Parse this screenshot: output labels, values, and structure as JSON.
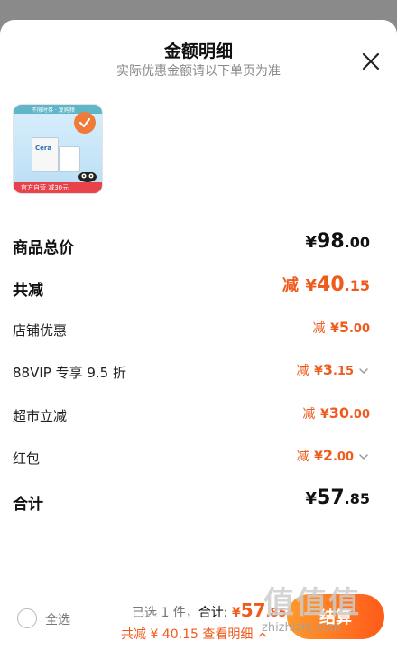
{
  "header": {
    "title": "金额明细",
    "subtitle": "实际优惠金额请以下单页为准"
  },
  "product": {
    "thumb_top_text": "不限时券 · 复购频",
    "thumb_mid_text": "Cera",
    "thumb_bottom_text": "官方自营 减30元"
  },
  "rows": {
    "subtotal": {
      "label": "商品总价",
      "currency": "¥",
      "int": "98",
      "dec": ".00"
    },
    "total_discount": {
      "label": "共减",
      "prefix": "减",
      "currency": "¥",
      "int": "40",
      "dec": ".15"
    },
    "shop_coupon": {
      "label": "店铺优惠",
      "prefix": "减",
      "currency": "¥",
      "int": "5",
      "dec": ".00"
    },
    "vip": {
      "label": "88VIP 专享 9.5 折",
      "prefix": "减",
      "currency": "¥",
      "int": "3",
      "dec": ".15"
    },
    "market": {
      "label": "超市立减",
      "prefix": "减",
      "currency": "¥",
      "int": "30",
      "dec": ".00"
    },
    "redpacket": {
      "label": "红包",
      "prefix": "减",
      "currency": "¥",
      "int": "2",
      "dec": ".00"
    },
    "total": {
      "label": "合计",
      "currency": "¥",
      "int": "57",
      "dec": ".85"
    }
  },
  "bottom_bar": {
    "select_all": "全选",
    "selected": "已选 1 件，",
    "total_label": "合计: ",
    "total_currency": "¥",
    "total_int": "57",
    "total_dec": ".85",
    "saved": "共减 ¥ 40.15",
    "details_link": "查看明细",
    "checkout": "结算"
  },
  "watermark": {
    "text": "值值值",
    "site": "zhizhizhi.com"
  },
  "colors": {
    "accent": "#ef5b1c",
    "checkout_gradient_start": "#ff9a2c",
    "checkout_gradient_end": "#ff5a1a"
  }
}
